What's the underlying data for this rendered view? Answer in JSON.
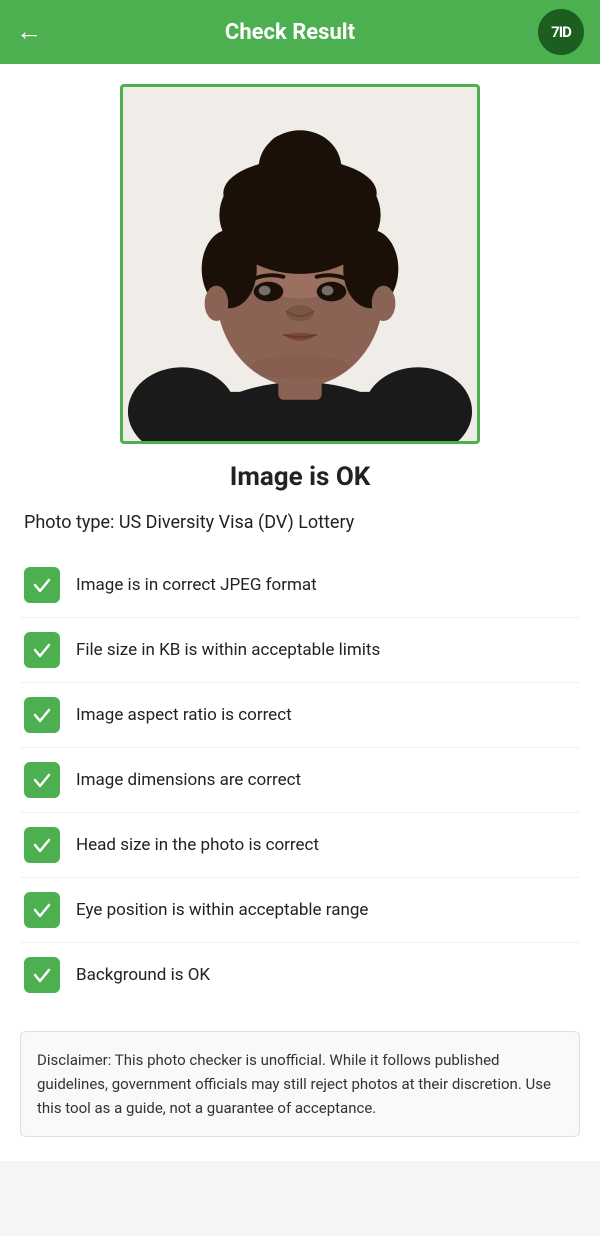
{
  "header": {
    "back_label": "←",
    "title": "Check Result",
    "logo_text": "7ID"
  },
  "status": {
    "title": "Image is OK"
  },
  "photo_type": {
    "label": "Photo type: US Diversity Visa (DV) Lottery"
  },
  "checks": [
    {
      "id": "jpeg",
      "label": "Image is in correct JPEG format",
      "passed": true
    },
    {
      "id": "filesize",
      "label": "File size in KB is within acceptable limits",
      "passed": true
    },
    {
      "id": "aspect",
      "label": "Image aspect ratio is correct",
      "passed": true
    },
    {
      "id": "dimensions",
      "label": "Image dimensions are correct",
      "passed": true
    },
    {
      "id": "headsize",
      "label": "Head size in the photo is correct",
      "passed": true
    },
    {
      "id": "eyepos",
      "label": "Eye position is within acceptable range",
      "passed": true
    },
    {
      "id": "background",
      "label": "Background is OK",
      "passed": true
    }
  ],
  "disclaimer": {
    "text": "Disclaimer: This photo checker is unofficial. While it follows published guidelines, government officials may still reject photos at their discretion. Use this tool as a guide, not a guarantee of acceptance."
  },
  "colors": {
    "green": "#4caf50",
    "dark_green": "#1b5e20"
  }
}
